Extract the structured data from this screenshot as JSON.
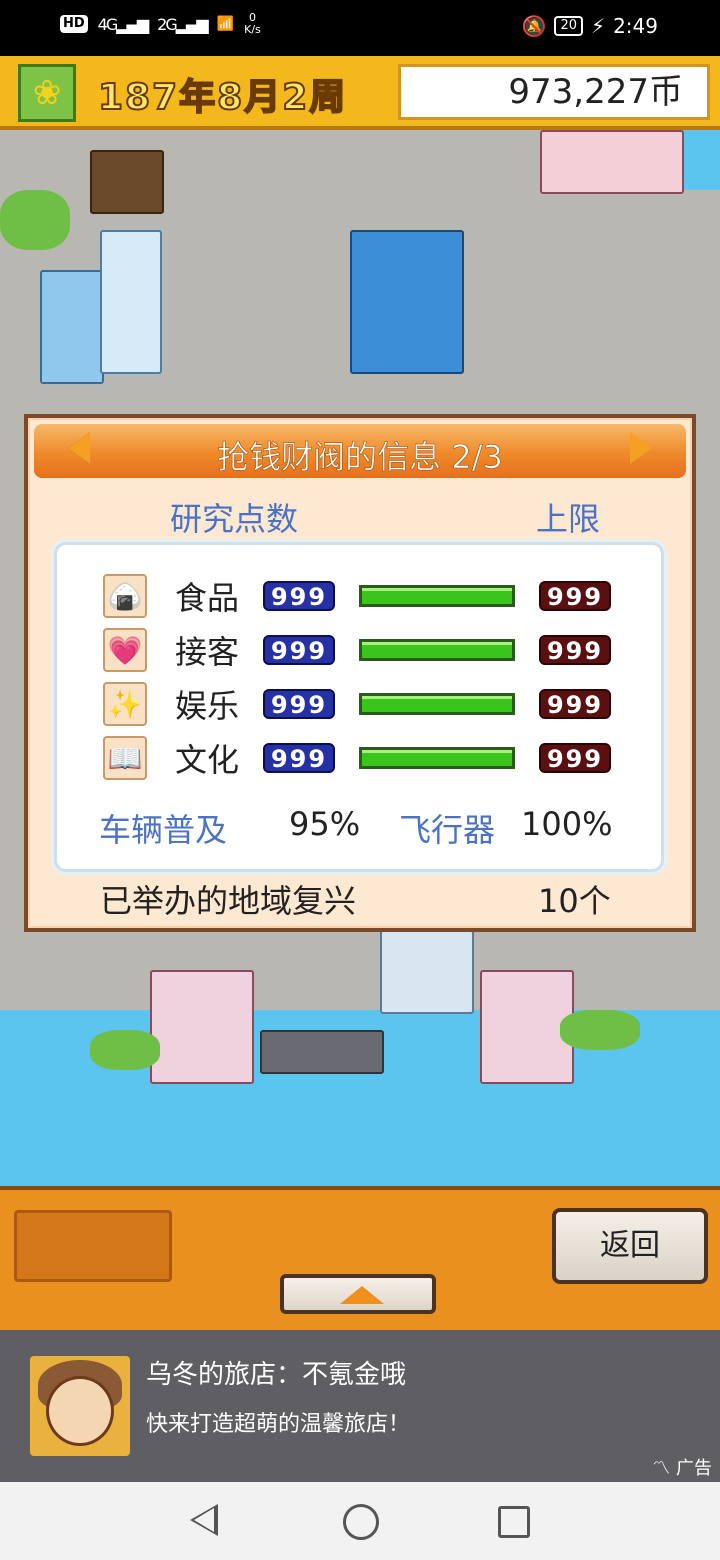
{
  "status": {
    "network": "HD",
    "net1": "4G",
    "net2": "2G",
    "speed_value": "0",
    "speed_unit": "K/s",
    "battery": "20",
    "time": "2:49"
  },
  "header": {
    "date": "187年8月2周",
    "money": "973,227币"
  },
  "dialog": {
    "title": "抢钱财阀的信息 2/3",
    "col_left": "研究点数",
    "col_right": "上限",
    "rows": [
      {
        "icon": "rice-ball-icon",
        "glyph": "🍙",
        "name": "食品",
        "value": "999",
        "max": "999",
        "fill": 1.0
      },
      {
        "icon": "heart-icon",
        "glyph": "💗",
        "name": "接客",
        "value": "999",
        "max": "999",
        "fill": 1.0
      },
      {
        "icon": "sparkle-icon",
        "glyph": "✨",
        "name": "娱乐",
        "value": "999",
        "max": "999",
        "fill": 1.0
      },
      {
        "icon": "book-icon",
        "glyph": "📖",
        "name": "文化",
        "value": "999",
        "max": "999",
        "fill": 1.0
      }
    ],
    "vehicle_label": "车辆普及",
    "vehicle_value": "95%",
    "aircraft_label": "飞行器",
    "aircraft_value": "100%",
    "revival_label": "已举办的地域复兴",
    "revival_value": "10个"
  },
  "controls": {
    "back_label": "返回"
  },
  "ad": {
    "title": "乌冬的旅店：不氪金哦",
    "subtitle": "快来打造超萌的温馨旅店！",
    "tag": "广告"
  }
}
